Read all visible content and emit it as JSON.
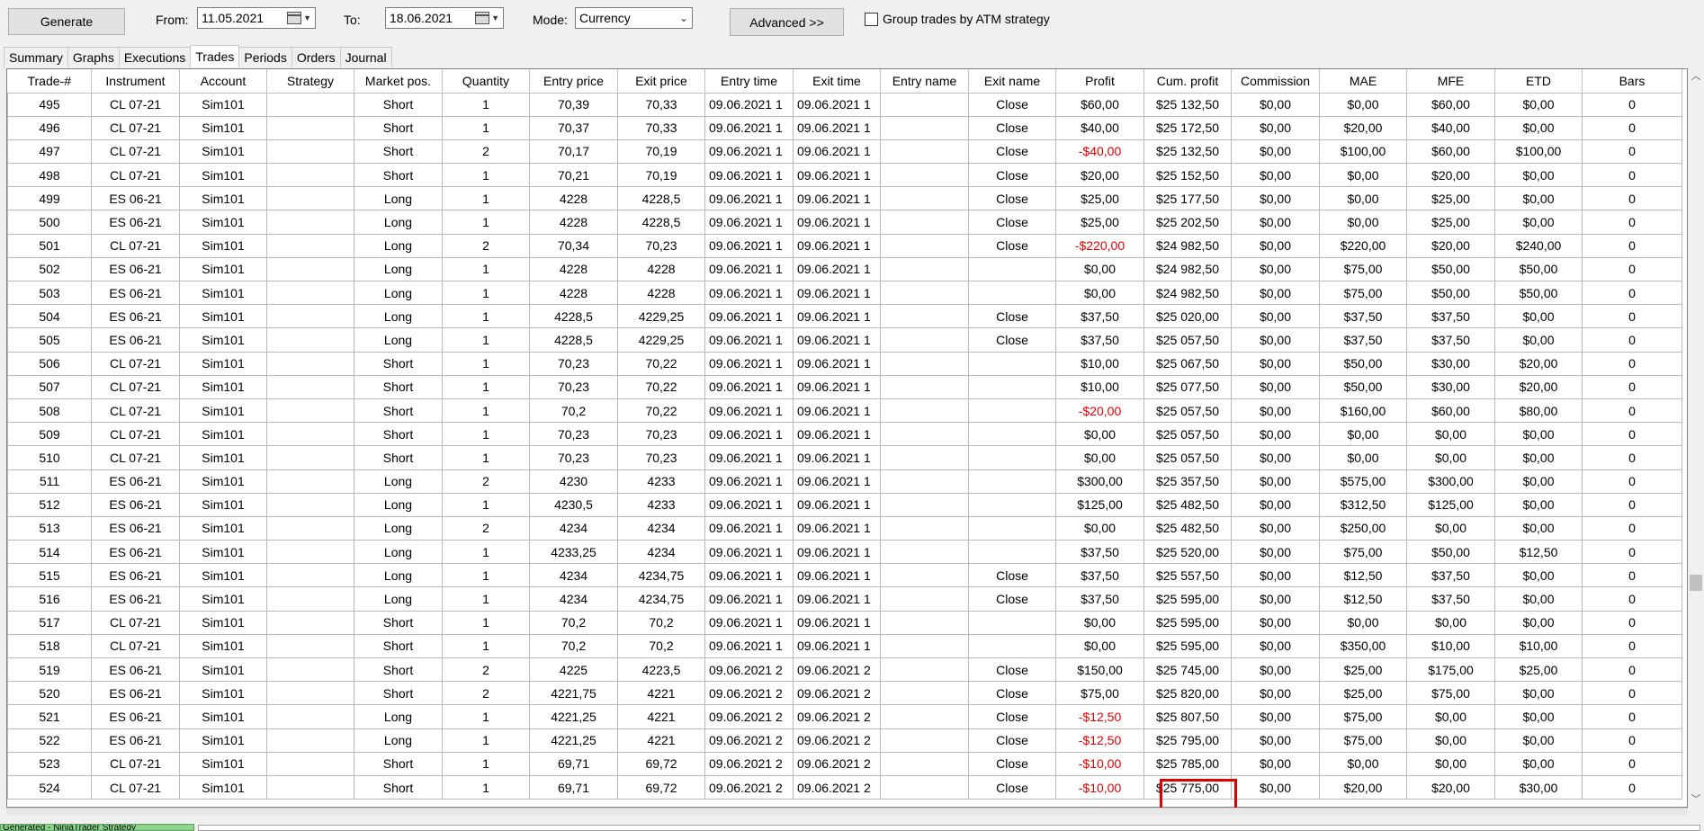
{
  "toolbar": {
    "generate_label": "Generate",
    "from_label": "From:",
    "from_date": "11.05.2021",
    "to_label": "To:",
    "to_date": "18.06.2021",
    "mode_label": "Mode:",
    "mode_value": "Currency",
    "advanced_label": "Advanced >>",
    "group_label": "Group trades by ATM strategy"
  },
  "tabs": [
    "Summary",
    "Graphs",
    "Executions",
    "Trades",
    "Periods",
    "Orders",
    "Journal"
  ],
  "active_tab": "Trades",
  "columns": [
    "Trade-#",
    "Instrument",
    "Account",
    "Strategy",
    "Market pos.",
    "Quantity",
    "Entry price",
    "Exit price",
    "Entry time",
    "Exit time",
    "Entry name",
    "Exit name",
    "Profit",
    "Cum. profit",
    "Commission",
    "MAE",
    "MFE",
    "ETD",
    "Bars"
  ],
  "rows": [
    [
      "495",
      "CL 07-21",
      "Sim101",
      "",
      "Short",
      "1",
      "70,39",
      "70,33",
      "09.06.2021 1",
      "09.06.2021 1",
      "",
      "Close",
      "$60,00",
      "$25 132,50",
      "$0,00",
      "$0,00",
      "$60,00",
      "$0,00",
      "0"
    ],
    [
      "496",
      "CL 07-21",
      "Sim101",
      "",
      "Short",
      "1",
      "70,37",
      "70,33",
      "09.06.2021 1",
      "09.06.2021 1",
      "",
      "Close",
      "$40,00",
      "$25 172,50",
      "$0,00",
      "$20,00",
      "$40,00",
      "$0,00",
      "0"
    ],
    [
      "497",
      "CL 07-21",
      "Sim101",
      "",
      "Short",
      "2",
      "70,17",
      "70,19",
      "09.06.2021 1",
      "09.06.2021 1",
      "",
      "Close",
      "-$40,00",
      "$25 132,50",
      "$0,00",
      "$100,00",
      "$60,00",
      "$100,00",
      "0"
    ],
    [
      "498",
      "CL 07-21",
      "Sim101",
      "",
      "Short",
      "1",
      "70,21",
      "70,19",
      "09.06.2021 1",
      "09.06.2021 1",
      "",
      "Close",
      "$20,00",
      "$25 152,50",
      "$0,00",
      "$0,00",
      "$20,00",
      "$0,00",
      "0"
    ],
    [
      "499",
      "ES 06-21",
      "Sim101",
      "",
      "Long",
      "1",
      "4228",
      "4228,5",
      "09.06.2021 1",
      "09.06.2021 1",
      "",
      "Close",
      "$25,00",
      "$25 177,50",
      "$0,00",
      "$0,00",
      "$25,00",
      "$0,00",
      "0"
    ],
    [
      "500",
      "ES 06-21",
      "Sim101",
      "",
      "Long",
      "1",
      "4228",
      "4228,5",
      "09.06.2021 1",
      "09.06.2021 1",
      "",
      "Close",
      "$25,00",
      "$25 202,50",
      "$0,00",
      "$0,00",
      "$25,00",
      "$0,00",
      "0"
    ],
    [
      "501",
      "CL 07-21",
      "Sim101",
      "",
      "Long",
      "2",
      "70,34",
      "70,23",
      "09.06.2021 1",
      "09.06.2021 1",
      "",
      "Close",
      "-$220,00",
      "$24 982,50",
      "$0,00",
      "$220,00",
      "$20,00",
      "$240,00",
      "0"
    ],
    [
      "502",
      "ES 06-21",
      "Sim101",
      "",
      "Long",
      "1",
      "4228",
      "4228",
      "09.06.2021 1",
      "09.06.2021 1",
      "",
      "",
      "$0,00",
      "$24 982,50",
      "$0,00",
      "$75,00",
      "$50,00",
      "$50,00",
      "0"
    ],
    [
      "503",
      "ES 06-21",
      "Sim101",
      "",
      "Long",
      "1",
      "4228",
      "4228",
      "09.06.2021 1",
      "09.06.2021 1",
      "",
      "",
      "$0,00",
      "$24 982,50",
      "$0,00",
      "$75,00",
      "$50,00",
      "$50,00",
      "0"
    ],
    [
      "504",
      "ES 06-21",
      "Sim101",
      "",
      "Long",
      "1",
      "4228,5",
      "4229,25",
      "09.06.2021 1",
      "09.06.2021 1",
      "",
      "Close",
      "$37,50",
      "$25 020,00",
      "$0,00",
      "$37,50",
      "$37,50",
      "$0,00",
      "0"
    ],
    [
      "505",
      "ES 06-21",
      "Sim101",
      "",
      "Long",
      "1",
      "4228,5",
      "4229,25",
      "09.06.2021 1",
      "09.06.2021 1",
      "",
      "Close",
      "$37,50",
      "$25 057,50",
      "$0,00",
      "$37,50",
      "$37,50",
      "$0,00",
      "0"
    ],
    [
      "506",
      "CL 07-21",
      "Sim101",
      "",
      "Short",
      "1",
      "70,23",
      "70,22",
      "09.06.2021 1",
      "09.06.2021 1",
      "",
      "",
      "$10,00",
      "$25 067,50",
      "$0,00",
      "$50,00",
      "$30,00",
      "$20,00",
      "0"
    ],
    [
      "507",
      "CL 07-21",
      "Sim101",
      "",
      "Short",
      "1",
      "70,23",
      "70,22",
      "09.06.2021 1",
      "09.06.2021 1",
      "",
      "",
      "$10,00",
      "$25 077,50",
      "$0,00",
      "$50,00",
      "$30,00",
      "$20,00",
      "0"
    ],
    [
      "508",
      "CL 07-21",
      "Sim101",
      "",
      "Short",
      "1",
      "70,2",
      "70,22",
      "09.06.2021 1",
      "09.06.2021 1",
      "",
      "",
      "-$20,00",
      "$25 057,50",
      "$0,00",
      "$160,00",
      "$60,00",
      "$80,00",
      "0"
    ],
    [
      "509",
      "CL 07-21",
      "Sim101",
      "",
      "Short",
      "1",
      "70,23",
      "70,23",
      "09.06.2021 1",
      "09.06.2021 1",
      "",
      "",
      "$0,00",
      "$25 057,50",
      "$0,00",
      "$0,00",
      "$0,00",
      "$0,00",
      "0"
    ],
    [
      "510",
      "CL 07-21",
      "Sim101",
      "",
      "Short",
      "1",
      "70,23",
      "70,23",
      "09.06.2021 1",
      "09.06.2021 1",
      "",
      "",
      "$0,00",
      "$25 057,50",
      "$0,00",
      "$0,00",
      "$0,00",
      "$0,00",
      "0"
    ],
    [
      "511",
      "ES 06-21",
      "Sim101",
      "",
      "Long",
      "2",
      "4230",
      "4233",
      "09.06.2021 1",
      "09.06.2021 1",
      "",
      "",
      "$300,00",
      "$25 357,50",
      "$0,00",
      "$575,00",
      "$300,00",
      "$0,00",
      "0"
    ],
    [
      "512",
      "ES 06-21",
      "Sim101",
      "",
      "Long",
      "1",
      "4230,5",
      "4233",
      "09.06.2021 1",
      "09.06.2021 1",
      "",
      "",
      "$125,00",
      "$25 482,50",
      "$0,00",
      "$312,50",
      "$125,00",
      "$0,00",
      "0"
    ],
    [
      "513",
      "ES 06-21",
      "Sim101",
      "",
      "Long",
      "2",
      "4234",
      "4234",
      "09.06.2021 1",
      "09.06.2021 1",
      "",
      "",
      "$0,00",
      "$25 482,50",
      "$0,00",
      "$250,00",
      "$0,00",
      "$0,00",
      "0"
    ],
    [
      "514",
      "ES 06-21",
      "Sim101",
      "",
      "Long",
      "1",
      "4233,25",
      "4234",
      "09.06.2021 1",
      "09.06.2021 1",
      "",
      "",
      "$37,50",
      "$25 520,00",
      "$0,00",
      "$75,00",
      "$50,00",
      "$12,50",
      "0"
    ],
    [
      "515",
      "ES 06-21",
      "Sim101",
      "",
      "Long",
      "1",
      "4234",
      "4234,75",
      "09.06.2021 1",
      "09.06.2021 1",
      "",
      "Close",
      "$37,50",
      "$25 557,50",
      "$0,00",
      "$12,50",
      "$37,50",
      "$0,00",
      "0"
    ],
    [
      "516",
      "ES 06-21",
      "Sim101",
      "",
      "Long",
      "1",
      "4234",
      "4234,75",
      "09.06.2021 1",
      "09.06.2021 1",
      "",
      "Close",
      "$37,50",
      "$25 595,00",
      "$0,00",
      "$12,50",
      "$37,50",
      "$0,00",
      "0"
    ],
    [
      "517",
      "CL 07-21",
      "Sim101",
      "",
      "Short",
      "1",
      "70,2",
      "70,2",
      "09.06.2021 1",
      "09.06.2021 1",
      "",
      "",
      "$0,00",
      "$25 595,00",
      "$0,00",
      "$0,00",
      "$0,00",
      "$0,00",
      "0"
    ],
    [
      "518",
      "CL 07-21",
      "Sim101",
      "",
      "Short",
      "1",
      "70,2",
      "70,2",
      "09.06.2021 1",
      "09.06.2021 1",
      "",
      "",
      "$0,00",
      "$25 595,00",
      "$0,00",
      "$350,00",
      "$10,00",
      "$10,00",
      "0"
    ],
    [
      "519",
      "ES 06-21",
      "Sim101",
      "",
      "Short",
      "2",
      "4225",
      "4223,5",
      "09.06.2021 2",
      "09.06.2021 2",
      "",
      "Close",
      "$150,00",
      "$25 745,00",
      "$0,00",
      "$25,00",
      "$175,00",
      "$25,00",
      "0"
    ],
    [
      "520",
      "ES 06-21",
      "Sim101",
      "",
      "Short",
      "2",
      "4221,75",
      "4221",
      "09.06.2021 2",
      "09.06.2021 2",
      "",
      "Close",
      "$75,00",
      "$25 820,00",
      "$0,00",
      "$25,00",
      "$75,00",
      "$0,00",
      "0"
    ],
    [
      "521",
      "ES 06-21",
      "Sim101",
      "",
      "Long",
      "1",
      "4221,25",
      "4221",
      "09.06.2021 2",
      "09.06.2021 2",
      "",
      "Close",
      "-$12,50",
      "$25 807,50",
      "$0,00",
      "$75,00",
      "$0,00",
      "$0,00",
      "0"
    ],
    [
      "522",
      "ES 06-21",
      "Sim101",
      "",
      "Long",
      "1",
      "4221,25",
      "4221",
      "09.06.2021 2",
      "09.06.2021 2",
      "",
      "Close",
      "-$12,50",
      "$25 795,00",
      "$0,00",
      "$75,00",
      "$0,00",
      "$0,00",
      "0"
    ],
    [
      "523",
      "CL 07-21",
      "Sim101",
      "",
      "Short",
      "1",
      "69,71",
      "69,72",
      "09.06.2021 2",
      "09.06.2021 2",
      "",
      "Close",
      "-$10,00",
      "$25 785,00",
      "$0,00",
      "$0,00",
      "$0,00",
      "$0,00",
      "0"
    ],
    [
      "524",
      "CL 07-21",
      "Sim101",
      "",
      "Short",
      "1",
      "69,71",
      "69,72",
      "09.06.2021 2",
      "09.06.2021 2",
      "",
      "Close",
      "-$10,00",
      "$25 775,00",
      "$0,00",
      "$20,00",
      "$20,00",
      "$30,00",
      "0"
    ]
  ],
  "status": {
    "tab_label": "Generated - NinjaTrader Strategy"
  },
  "colors": {
    "negative": "#e00000",
    "highlight": "#e00000",
    "status_tab": "#8ed38e"
  },
  "icons": {
    "calendar": "calendar-icon",
    "dropdown": "chevron-down-icon",
    "scroll_up": "scroll-up-icon",
    "scroll_down": "scroll-down-icon"
  }
}
